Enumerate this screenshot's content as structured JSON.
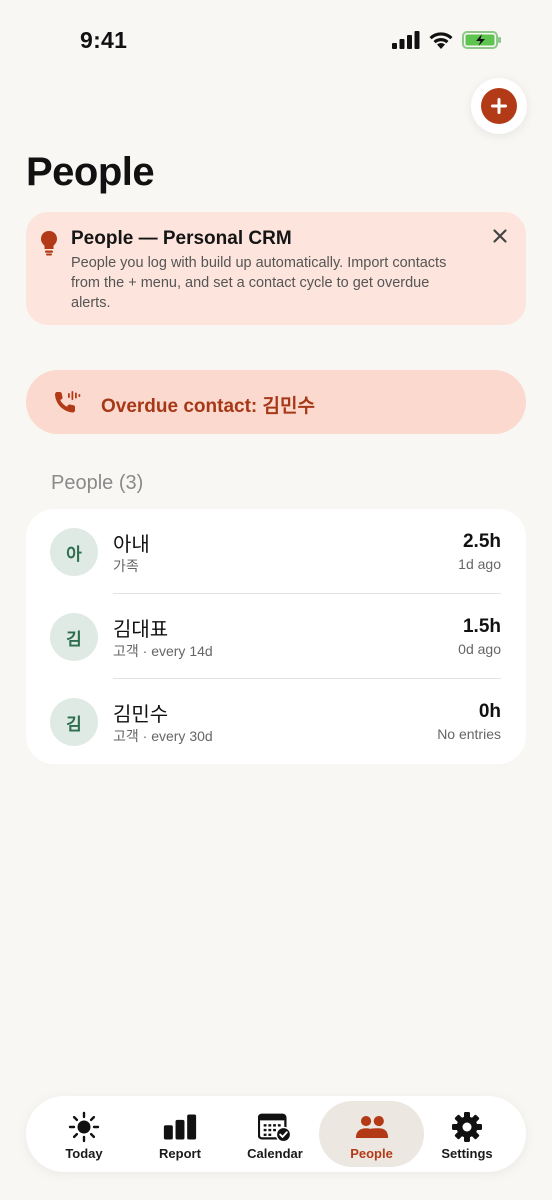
{
  "status_bar": {
    "time": "9:41"
  },
  "header": {
    "title": "People",
    "add_icon": "plus-icon"
  },
  "tip": {
    "title": "People — Personal CRM",
    "body": "People you log with build up automatically. Import contacts from the + menu, and set a contact cycle to get overdue alerts.",
    "icon": "lightbulb-icon",
    "close_icon": "close-icon"
  },
  "overdue": {
    "text": "Overdue contact: 김민수",
    "icon": "phone-ringing-icon"
  },
  "people": {
    "section_title": "People (3)",
    "items": [
      {
        "avatar": "아",
        "name": "아내",
        "sub": "가족",
        "hours": "2.5h",
        "meta": "1d ago"
      },
      {
        "avatar": "김",
        "name": "김대표",
        "sub": "고객 · every 14d",
        "hours": "1.5h",
        "meta": "0d ago"
      },
      {
        "avatar": "김",
        "name": "김민수",
        "sub": "고객 · every 30d",
        "hours": "0h",
        "meta": "No entries"
      }
    ]
  },
  "tabs": [
    {
      "label": "Today",
      "icon": "sun-icon"
    },
    {
      "label": "Report",
      "icon": "bar-chart-icon"
    },
    {
      "label": "Calendar",
      "icon": "calendar-icon"
    },
    {
      "label": "People",
      "icon": "people-icon",
      "active": true
    },
    {
      "label": "Settings",
      "icon": "gear-icon"
    }
  ],
  "colors": {
    "accent": "#b23a16",
    "tip_bg": "#fde4dc",
    "overdue_bg": "#fcd9ce",
    "avatar_bg": "#dfeae4"
  }
}
